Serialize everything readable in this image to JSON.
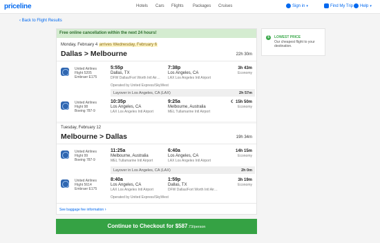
{
  "brand": "priceline",
  "nav": [
    "Hotels",
    "Cars",
    "Flights",
    "Packages",
    "Cruises"
  ],
  "account": {
    "sign_in": "Sign in",
    "find_trip": "Find My Trip",
    "help": "Help"
  },
  "back_link": "Back to Flight Results",
  "cancel_banner": "Free online cancellation within the next 24 hours!",
  "outbound": {
    "date": "Monday, February 4",
    "arrives": "arrives Wednesday, February 6",
    "route": "Dallas > Melbourne",
    "duration": "22h 30m",
    "segments": [
      {
        "airline": "United Airlines",
        "flight": "Flight 5205",
        "aircraft": "Embraer E175",
        "dep_time": "5:55p",
        "dep_city": "Dallas, TX",
        "dep_airport": "DFW Dallas/Fort Worth Intl Air…",
        "arr_time": "7:38p",
        "arr_city": "Los Angeles, CA",
        "arr_airport": "LAX Los Angeles Intl Airport",
        "seg_duration": "3h 43m",
        "cabin": "Economy",
        "operated": "Operated by United Express/SkyWest"
      },
      {
        "airline": "United Airlines",
        "flight": "Flight 98",
        "aircraft": "Boeing 787-9",
        "dep_time": "10:35p",
        "dep_city": "Los Angeles, CA",
        "dep_airport": "LAX Los Angeles Intl Airport",
        "arr_time": "9:25a",
        "arr_city": "Melbourne, Australia",
        "arr_airport": "MEL Tullamarine Intl Airport",
        "seg_duration": "15h 50m",
        "cabin": "Economy"
      }
    ],
    "layover": {
      "text": "Layover in Los Angeles, CA (LAX)",
      "duration": "2h 57m"
    }
  },
  "return": {
    "date": "Tuesday, February 12",
    "route": "Melbourne > Dallas",
    "duration": "19h 34m",
    "segments": [
      {
        "airline": "United Airlines",
        "flight": "Flight 99",
        "aircraft": "Boeing 787-9",
        "dep_time": "11:25a",
        "dep_city": "Melbourne, Australia",
        "dep_airport": "MEL Tullamarine Intl Airport",
        "arr_time": "6:40a",
        "arr_city": "Los Angeles, CA",
        "arr_airport": "LAX Los Angeles Intl Airport",
        "seg_duration": "14h 15m",
        "cabin": "Economy"
      },
      {
        "airline": "United Airlines",
        "flight": "Flight 5614",
        "aircraft": "Embraer E175",
        "dep_time": "8:40a",
        "dep_city": "Los Angeles, CA",
        "dep_airport": "LAX Los Angeles Intl Airport",
        "arr_time": "1:59p",
        "arr_city": "Dallas, TX",
        "arr_airport": "DFW Dallas/Fort Worth Intl Air…",
        "seg_duration": "3h 19m",
        "cabin": "Economy",
        "operated": "Operated by United Express/SkyWest"
      }
    ],
    "layover": {
      "text": "Layover in Los Angeles, CA (LAX)",
      "duration": "2h 0m"
    }
  },
  "baggage_link": "See baggage fee information",
  "lowest_price": {
    "title": "LOWEST PRICE",
    "text": "Our cheapest flight to your destination."
  },
  "checkout": {
    "label": "Continue to Checkout for $587",
    "cents": ".73/person"
  },
  "colors": {
    "brand": "#0068ef",
    "green": "#35a244",
    "banner": "#d4ecd0"
  }
}
